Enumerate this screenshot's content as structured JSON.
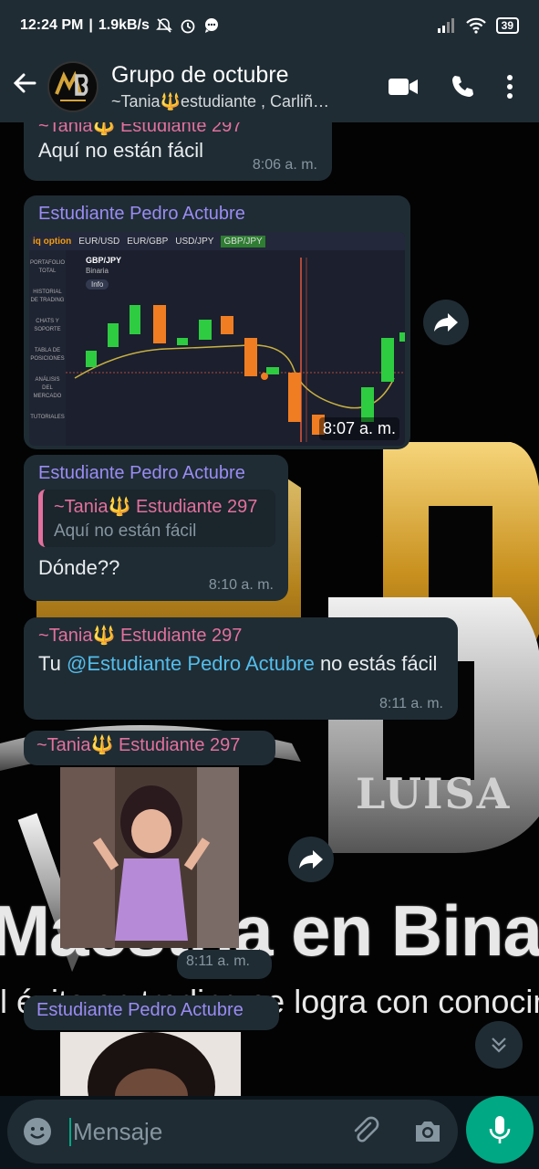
{
  "status_bar": {
    "time": "12:24 PM",
    "speed": "1.9kB/s",
    "battery": "39"
  },
  "header": {
    "title": "Grupo de octubre",
    "subtitle": "~Tania🔱estudiante , Carliñ…",
    "avatar_text": "MB"
  },
  "wallpaper": {
    "line1": "Maestría en Binar",
    "line2": "l éxito en trading se logra con conocimie",
    "side_text": "LUISA"
  },
  "messages": [
    {
      "sender": "~Tania🔱 Estudiante 297",
      "text": "Aquí no están fácil",
      "time": "8:06 a. m."
    },
    {
      "sender": "Estudiante Pedro Actubre",
      "time": "8:07 a. m.",
      "chart": {
        "pair": "GBP/JPY",
        "subtype": "Binaria",
        "brand": "iq option",
        "tabs": [
          "EUR/USD",
          "EUR/GBP",
          "USD/JPY",
          "GBP/JPY"
        ],
        "sidebar": [
          "PORTAFOLIO TOTAL",
          "HISTORIAL DE TRADING",
          "CHATS Y SOPORTE",
          "TABLA DE POSICIONES",
          "ANÁLISIS DEL MERCADO",
          "TUTORIALES"
        ],
        "info": "Info"
      }
    },
    {
      "sender": "Estudiante Pedro Actubre",
      "quote_sender": "~Tania🔱 Estudiante 297",
      "quote_text": "Aquí no están fácil",
      "text": "Dónde??",
      "time": "8:10 a. m."
    },
    {
      "sender": "~Tania🔱 Estudiante 297",
      "text_pre": "Tu ",
      "mention": "@Estudiante Pedro Actubre",
      "text_post": " no estás fácil",
      "time": "8:11 a. m."
    },
    {
      "sender": "~Tania🔱 Estudiante 297",
      "time": "8:11 a. m."
    },
    {
      "sender": "Estudiante Pedro Actubre"
    }
  ],
  "composer": {
    "placeholder": "Mensaje"
  },
  "colors": {
    "bubble": "#1f2c34",
    "accent": "#00a884",
    "pink_sender": "#e3709d",
    "purple_sender": "#9a8cf3",
    "mention": "#53bdeb"
  }
}
